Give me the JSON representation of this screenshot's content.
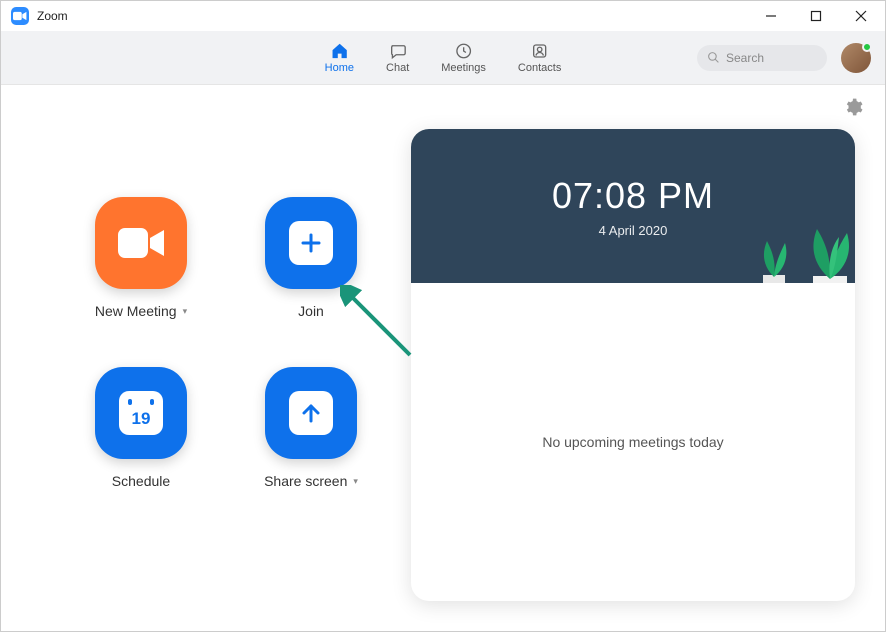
{
  "window": {
    "title": "Zoom"
  },
  "nav": {
    "home": "Home",
    "chat": "Chat",
    "meetings": "Meetings",
    "contacts": "Contacts"
  },
  "search": {
    "placeholder": "Search"
  },
  "actions": {
    "new_meeting": "New Meeting",
    "join": "Join",
    "schedule": "Schedule",
    "schedule_day": "19",
    "share_screen": "Share screen"
  },
  "calendar": {
    "time": "07:08 PM",
    "date": "4 April 2020",
    "empty": "No upcoming meetings today"
  }
}
